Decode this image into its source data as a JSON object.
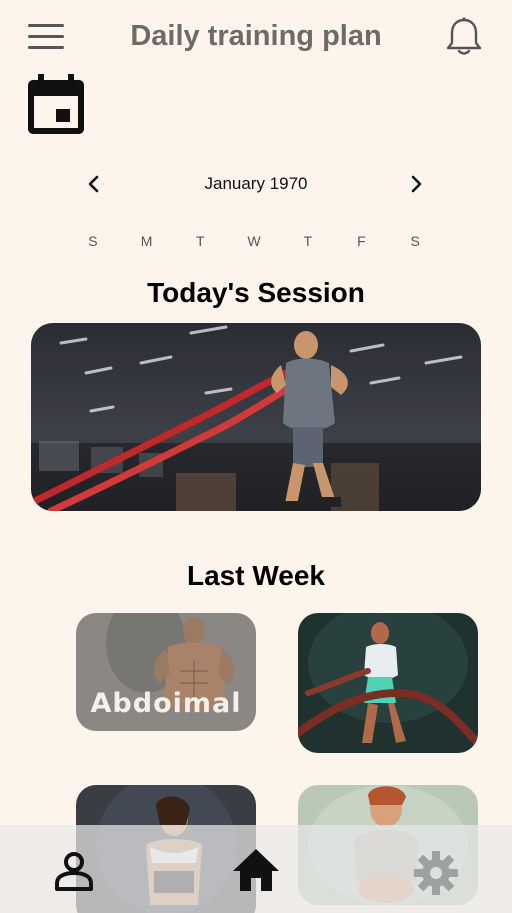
{
  "header": {
    "title": "Daily training plan",
    "menu_icon": "menu-icon",
    "notification_icon": "bell-icon"
  },
  "calendar": {
    "icon": "calendar-icon",
    "month_label": "January 1970",
    "prev_icon": "chevron-left-icon",
    "next_icon": "chevron-right-icon",
    "weekdays": [
      "S",
      "M",
      "T",
      "W",
      "T",
      "F",
      "S"
    ]
  },
  "today": {
    "title": "Today's Session"
  },
  "last_week": {
    "title": "Last Week",
    "cards": [
      {
        "label": "Abdoimal"
      },
      {
        "label": ""
      },
      {
        "label": ""
      },
      {
        "label": ""
      }
    ]
  },
  "bottom_nav": {
    "items": [
      "profile-icon",
      "home-icon",
      "settings-icon"
    ]
  },
  "colors": {
    "background": "#fdf5ec",
    "title_gray": "#6e6a66",
    "nav_bar": "#e8e8e8",
    "rope_red": "#c0282c"
  }
}
